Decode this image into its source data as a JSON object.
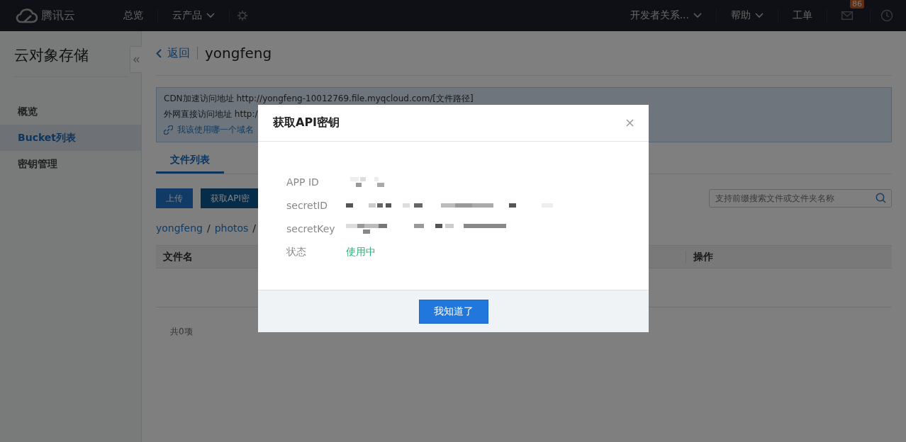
{
  "topbar": {
    "logo": "腾讯云",
    "nav": [
      {
        "label": "总览",
        "dropdown": false
      },
      {
        "label": "云产品",
        "dropdown": true
      }
    ],
    "right": [
      {
        "label": "开发者关系...",
        "dropdown": true
      },
      {
        "label": "帮助",
        "dropdown": true
      },
      {
        "label": "工单",
        "dropdown": false
      }
    ],
    "mail_badge": "86"
  },
  "sidebar": {
    "title": "云对象存储",
    "items": [
      {
        "label": "概览",
        "selected": false
      },
      {
        "label": "Bucket列表",
        "selected": true
      },
      {
        "label": "密钥管理",
        "selected": false
      }
    ]
  },
  "page": {
    "back": "返回",
    "title": "yongfeng",
    "notice": [
      "CDN加速访问地址 http://yongfeng-10012769.file.myqcloud.com/[文件路径]",
      "外网直接访问地址 http:/"
    ],
    "notice_link": "我该使用哪一个域名",
    "tabs": [
      {
        "label": "文件列表",
        "selected": true
      }
    ],
    "buttons": [
      "上传",
      "获取API密"
    ],
    "search": {
      "placeholder": "支持前缀搜索文件或文件夹名称"
    },
    "breadcrumb": [
      {
        "label": "yongfeng",
        "separator": "/"
      },
      {
        "label": "photos",
        "separator": "/"
      }
    ],
    "columns": [
      "文件名",
      "操作"
    ],
    "total": "共0项"
  },
  "dialog": {
    "title": "获取API密钥",
    "fields": [
      {
        "label": "APP ID",
        "kind": "masked"
      },
      {
        "label": "secretID",
        "kind": "masked"
      },
      {
        "label": "secretKey",
        "kind": "masked"
      },
      {
        "label": "状态",
        "kind": "status",
        "value": "使用中"
      }
    ],
    "button": "我知道了"
  }
}
